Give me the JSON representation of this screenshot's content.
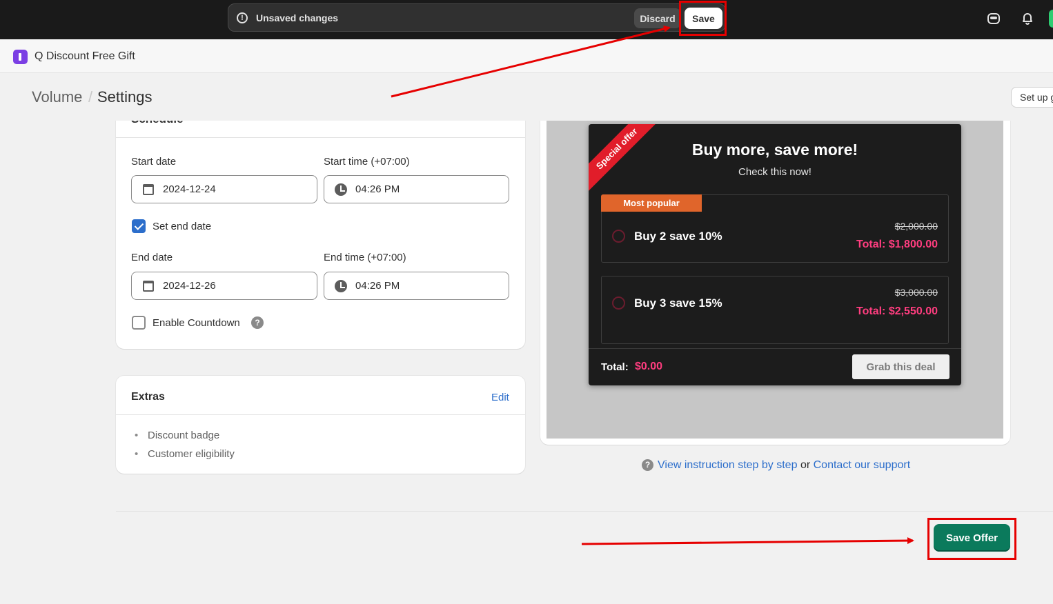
{
  "topbar": {
    "unsaved_message": "Unsaved changes",
    "discard_label": "Discard",
    "save_label": "Save"
  },
  "app": {
    "name": "Q Discount Free Gift"
  },
  "header": {
    "breadcrumb": "Volume",
    "separator": "/",
    "title": "Settings",
    "setup_button": "Set up g"
  },
  "schedule": {
    "title": "Schedule",
    "start_date_label": "Start date",
    "start_date": "2024-12-24",
    "start_time_label": "Start time (+07:00)",
    "start_time": "04:26 PM",
    "set_end_date_label": "Set end date",
    "set_end_date_checked": true,
    "end_date_label": "End date",
    "end_date": "2024-12-26",
    "end_time_label": "End time (+07:00)",
    "end_time": "04:26 PM",
    "countdown_label": "Enable Countdown",
    "countdown_checked": false
  },
  "extras": {
    "title": "Extras",
    "edit_label": "Edit",
    "items": [
      "Discount badge",
      "Customer eligibility"
    ]
  },
  "preview": {
    "ribbon": "Special offer",
    "title": "Buy more, save more!",
    "subtitle": "Check this now!",
    "offers": [
      {
        "tag": "Most popular",
        "name": "Buy 2 save 10%",
        "original_price": "$2,000.00",
        "total_label": "Total:",
        "total": "$1,800.00"
      },
      {
        "tag": "",
        "name": "Buy 3 save 15%",
        "original_price": "$3,000.00",
        "total_label": "Total:",
        "total": "$2,550.00"
      }
    ],
    "footer_total_label": "Total:",
    "footer_total": "$0.00",
    "cta": "Grab this deal"
  },
  "help": {
    "instruction_link": "View instruction step by step",
    "or_text": "or",
    "support_link": "Contact our support"
  },
  "actions": {
    "save_offer_label": "Save Offer"
  },
  "colors": {
    "accent": "#0b7a5c",
    "highlight": "#e60000",
    "price_pink": "#ff3d7f",
    "popular_orange": "#e0652b"
  }
}
